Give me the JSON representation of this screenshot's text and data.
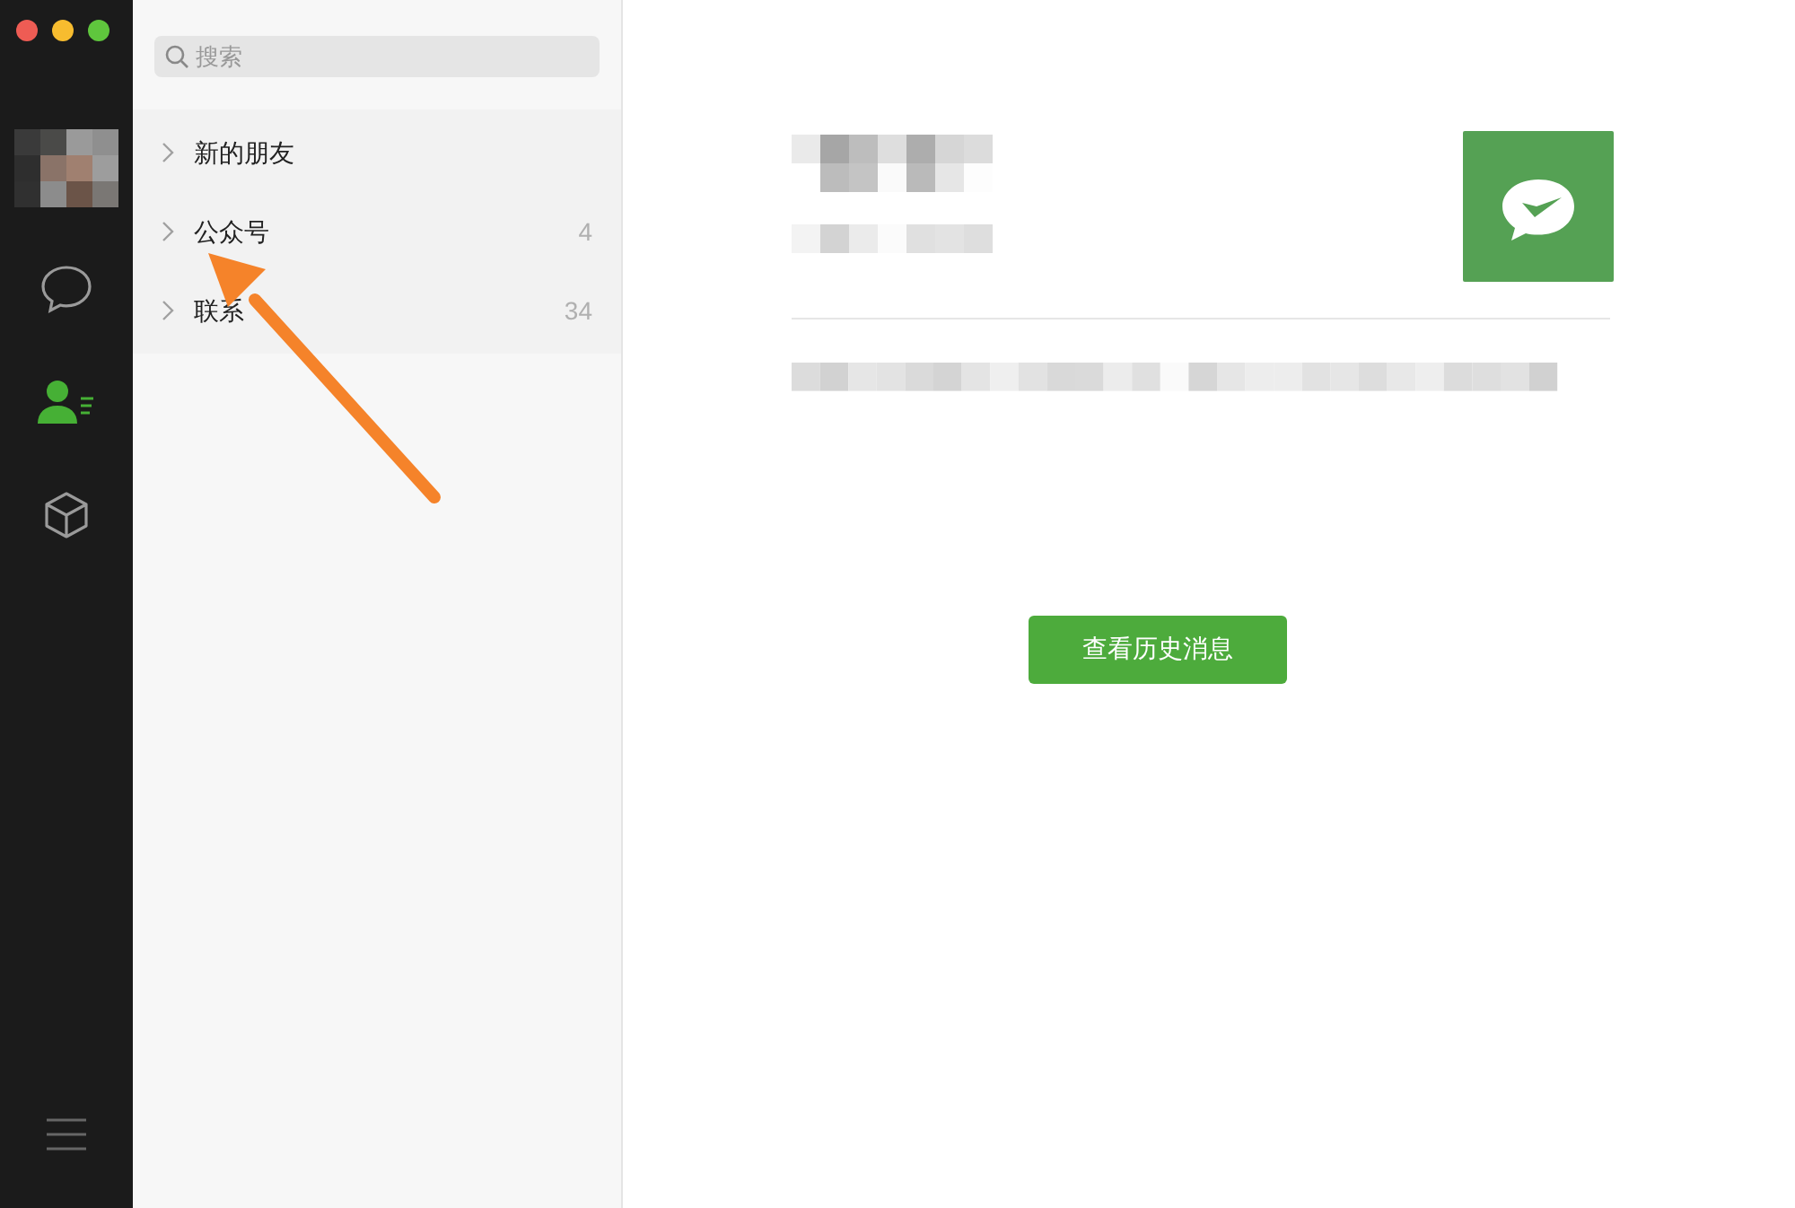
{
  "search": {
    "placeholder": "搜索"
  },
  "nav": [
    {
      "kind": "chat",
      "selected": false
    },
    {
      "kind": "contacts",
      "selected": true
    },
    {
      "kind": "cube",
      "selected": false
    }
  ],
  "contacts": [
    {
      "label": "新的朋友"
    },
    {
      "label": "公众号",
      "count": "4"
    },
    {
      "label": "联系",
      "count": "34"
    }
  ],
  "detail": {
    "button": "查看历史消息"
  }
}
